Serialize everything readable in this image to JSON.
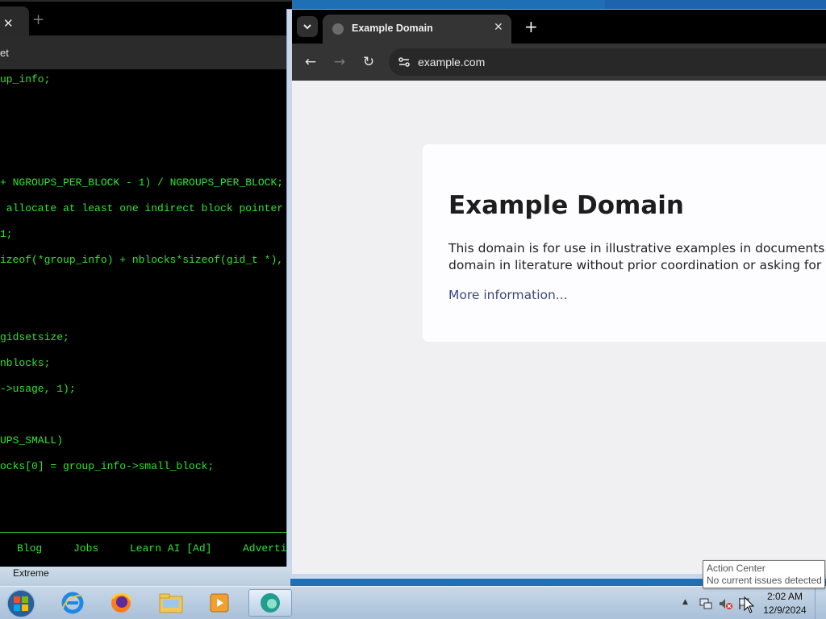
{
  "left_window": {
    "tab_close": "✕",
    "new_tab": "+",
    "toolbar_text": "et",
    "code_lines": [
      "up_info;",
      "+ NGROUPS_PER_BLOCK - 1) / NGROUPS_PER_BLOCK;",
      " allocate at least one indirect block pointer",
      "1;",
      "izeof(*group_info) + nblocks*sizeof(gid_t *),",
      "gidsetsize;",
      "nblocks;",
      "->usage, 1);",
      "UPS_SMALL)",
      "ocks[0] = group_info->small_block;"
    ],
    "nav_links": [
      "Blog",
      "Jobs",
      "Learn AI [Ad]",
      "Adverti"
    ]
  },
  "right_window": {
    "tab_title": "Example Domain",
    "tab_close": "✕",
    "new_tab": "+",
    "url": "example.com",
    "page": {
      "heading": "Example Domain",
      "paragraph_line1": "This domain is for use in illustrative examples in documents. You m",
      "paragraph_line2": "domain in literature without prior coordination or asking for permi",
      "link_text": "More information..."
    }
  },
  "fragment_text": "Extreme",
  "taskbar": {
    "time": "2:02 AM",
    "date": "12/9/2024",
    "tray_arrow": "▲"
  },
  "tooltip": {
    "title": "Action Center",
    "body": "No current issues detected"
  }
}
